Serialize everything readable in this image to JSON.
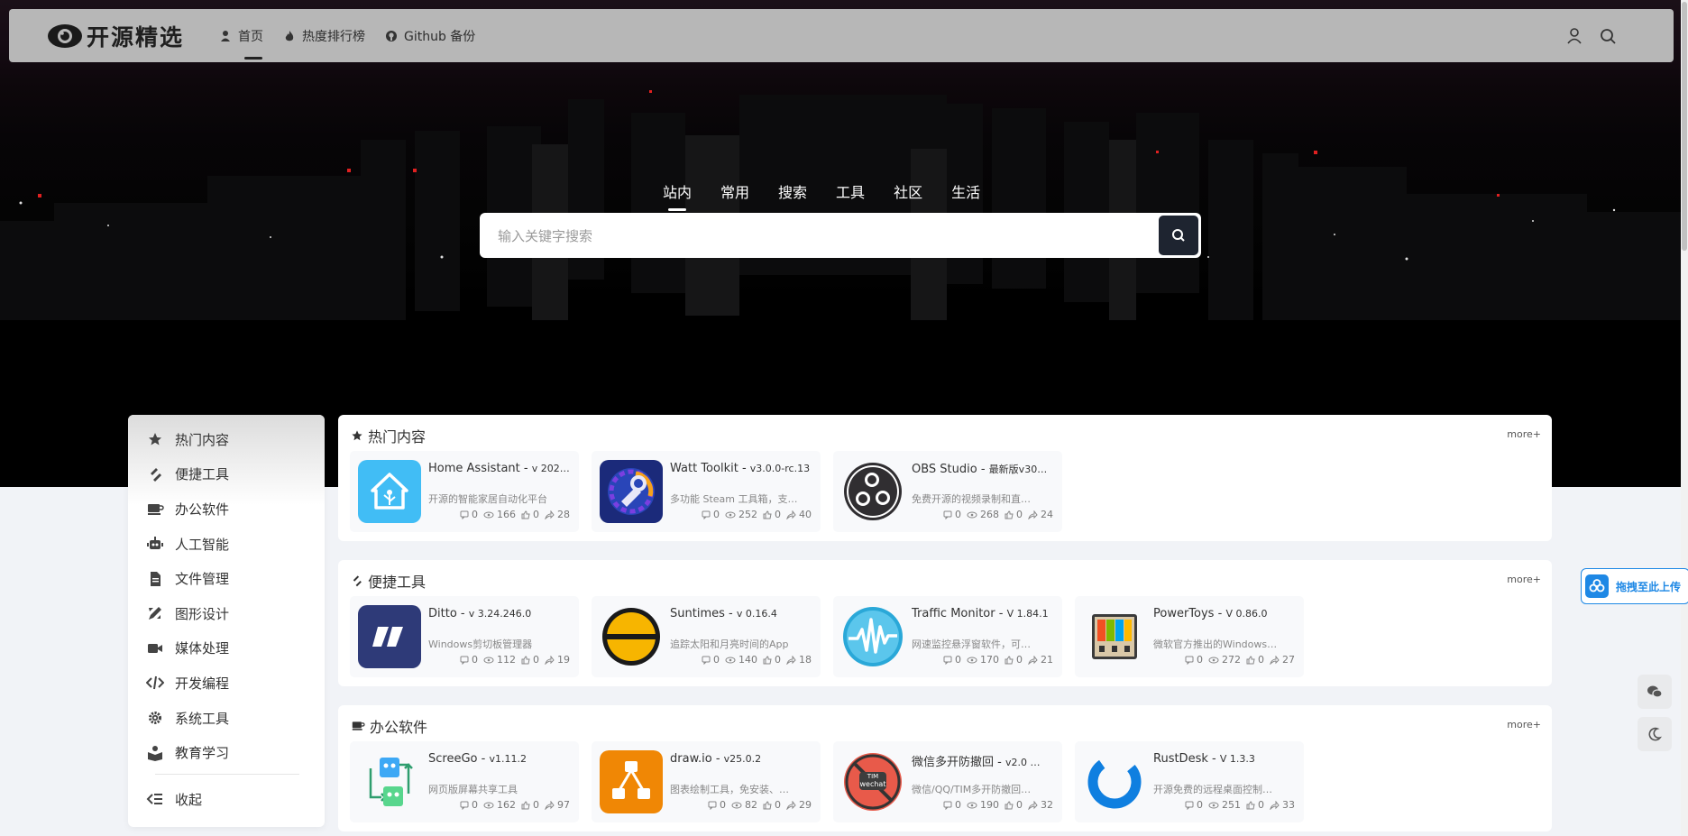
{
  "site": {
    "logo_text": "开源精选"
  },
  "nav": {
    "items": [
      {
        "label": "首页",
        "icon": "user-icon",
        "active": true
      },
      {
        "label": "热度排行榜",
        "icon": "fire-icon"
      },
      {
        "label": "Github 备份",
        "icon": "github-icon"
      }
    ],
    "right_icons": [
      "user-icon",
      "search-icon"
    ]
  },
  "search": {
    "tabs": [
      "站内",
      "常用",
      "搜索",
      "工具",
      "社区",
      "生活"
    ],
    "active_tab": "站内",
    "placeholder": "输入关键字搜索"
  },
  "sidebar": {
    "items": [
      {
        "label": "热门内容",
        "icon": "star-icon"
      },
      {
        "label": "便捷工具",
        "icon": "tools-icon"
      },
      {
        "label": "办公软件",
        "icon": "coffee-cup-icon"
      },
      {
        "label": "人工智能",
        "icon": "robot-icon"
      },
      {
        "label": "文件管理",
        "icon": "file-icon"
      },
      {
        "label": "图形设计",
        "icon": "design-icon"
      },
      {
        "label": "媒体处理",
        "icon": "video-icon"
      },
      {
        "label": "开发编程",
        "icon": "code-icon"
      },
      {
        "label": "系统工具",
        "icon": "gear-icon"
      },
      {
        "label": "教育学习",
        "icon": "education-icon"
      }
    ],
    "collapse_label": "收起"
  },
  "sections": [
    {
      "title": "热门内容",
      "icon": "star-icon",
      "more": "more+",
      "cards": [
        {
          "name": "Home Assistant",
          "version": "v 202…",
          "desc": "开源的智能家居自动化平台",
          "comments": "0",
          "views": "166",
          "likes": "0",
          "shares": "28",
          "icon": "home-assistant-icon"
        },
        {
          "name": "Watt Toolkit",
          "version": "v3.0.0-rc.13",
          "desc": "多功能 Steam 工具箱，支…",
          "comments": "0",
          "views": "252",
          "likes": "0",
          "shares": "40",
          "icon": "watt-toolkit-icon"
        },
        {
          "name": "OBS Studio",
          "version": "最新版v30…",
          "desc": "免费开源的视频录制和直…",
          "comments": "0",
          "views": "268",
          "likes": "0",
          "shares": "24",
          "icon": "obs-icon"
        }
      ]
    },
    {
      "title": "便捷工具",
      "icon": "tools-icon",
      "more": "more+",
      "cards": [
        {
          "name": "Ditto",
          "version": "v 3.24.246.0",
          "desc": "Windows剪切板管理器",
          "comments": "0",
          "views": "112",
          "likes": "0",
          "shares": "19",
          "icon": "ditto-icon"
        },
        {
          "name": "Suntimes",
          "version": "v 0.16.4",
          "desc": "追踪太阳和月亮时间的App",
          "comments": "0",
          "views": "140",
          "likes": "0",
          "shares": "18",
          "icon": "suntimes-icon"
        },
        {
          "name": "Traffic Monitor",
          "version": "V 1.84.1",
          "desc": "网速监控悬浮窗软件，可…",
          "comments": "0",
          "views": "170",
          "likes": "0",
          "shares": "21",
          "icon": "traffic-monitor-icon"
        },
        {
          "name": "PowerToys",
          "version": "V 0.86.0",
          "desc": "微软官方推出的Windows…",
          "comments": "0",
          "views": "272",
          "likes": "0",
          "shares": "27",
          "icon": "powertoys-icon"
        }
      ]
    },
    {
      "title": "办公软件",
      "icon": "coffee-cup-icon",
      "more": "more+",
      "cards": [
        {
          "name": "ScreeGo",
          "version": "v1.11.2",
          "desc": "网页版屏幕共享工具",
          "comments": "0",
          "views": "162",
          "likes": "0",
          "shares": "97",
          "icon": "screego-icon"
        },
        {
          "name": "draw.io",
          "version": "v25.0.2",
          "desc": "图表绘制工具，免安装、…",
          "comments": "0",
          "views": "82",
          "likes": "0",
          "shares": "29",
          "icon": "drawio-icon"
        },
        {
          "name": "微信多开防撤回",
          "version": "v2.0 …",
          "desc": "微信/QQ/TIM多开防撤回…",
          "comments": "0",
          "views": "190",
          "likes": "0",
          "shares": "32",
          "icon": "wechat-tim-icon"
        },
        {
          "name": "RustDesk",
          "version": "V 1.3.3",
          "desc": "开源免费的远程桌面控制…",
          "comments": "0",
          "views": "251",
          "likes": "0",
          "shares": "33",
          "icon": "rustdesk-icon"
        }
      ]
    }
  ],
  "upload": {
    "label": "拖拽至此上传"
  },
  "floating": [
    "wechat-icon",
    "moon-icon"
  ]
}
